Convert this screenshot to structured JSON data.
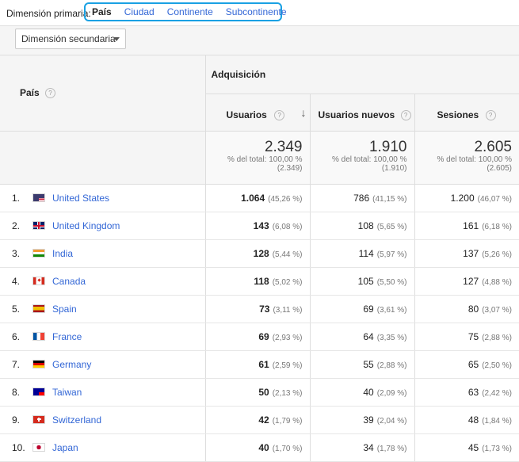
{
  "primary_dimension": {
    "label": "Dimensión primaria:",
    "tabs": [
      "País",
      "Ciudad",
      "Continente",
      "Subcontinente"
    ]
  },
  "secondary_dimension": {
    "label": "Dimensión secundaria"
  },
  "table": {
    "country_header": "País",
    "group_header": "Adquisición",
    "metric_headers": [
      "Usuarios",
      "Usuarios nuevos",
      "Sesiones"
    ],
    "totals": [
      {
        "value": "2.349",
        "line1": "% del total: 100,00 %",
        "line2": "(2.349)"
      },
      {
        "value": "1.910",
        "line1": "% del total: 100,00 %",
        "line2": "(1.910)"
      },
      {
        "value": "2.605",
        "line1": "% del total: 100,00 %",
        "line2": "(2.605)"
      }
    ],
    "rows": [
      {
        "index": "1.",
        "flag": "us-flag-icon",
        "country": "United States",
        "users": "1.064",
        "users_pct": "(45,26 %)",
        "new_users": "786",
        "new_users_pct": "(41,15 %)",
        "sessions": "1.200",
        "sessions_pct": "(46,07 %)"
      },
      {
        "index": "2.",
        "flag": "gb-flag-icon",
        "country": "United Kingdom",
        "users": "143",
        "users_pct": "(6,08 %)",
        "new_users": "108",
        "new_users_pct": "(5,65 %)",
        "sessions": "161",
        "sessions_pct": "(6,18 %)"
      },
      {
        "index": "3.",
        "flag": "in-flag-icon",
        "country": "India",
        "users": "128",
        "users_pct": "(5,44 %)",
        "new_users": "114",
        "new_users_pct": "(5,97 %)",
        "sessions": "137",
        "sessions_pct": "(5,26 %)"
      },
      {
        "index": "4.",
        "flag": "ca-flag-icon",
        "country": "Canada",
        "users": "118",
        "users_pct": "(5,02 %)",
        "new_users": "105",
        "new_users_pct": "(5,50 %)",
        "sessions": "127",
        "sessions_pct": "(4,88 %)"
      },
      {
        "index": "5.",
        "flag": "es-flag-icon",
        "country": "Spain",
        "users": "73",
        "users_pct": "(3,11 %)",
        "new_users": "69",
        "new_users_pct": "(3,61 %)",
        "sessions": "80",
        "sessions_pct": "(3,07 %)"
      },
      {
        "index": "6.",
        "flag": "fr-flag-icon",
        "country": "France",
        "users": "69",
        "users_pct": "(2,93 %)",
        "new_users": "64",
        "new_users_pct": "(3,35 %)",
        "sessions": "75",
        "sessions_pct": "(2,88 %)"
      },
      {
        "index": "7.",
        "flag": "de-flag-icon",
        "country": "Germany",
        "users": "61",
        "users_pct": "(2,59 %)",
        "new_users": "55",
        "new_users_pct": "(2,88 %)",
        "sessions": "65",
        "sessions_pct": "(2,50 %)"
      },
      {
        "index": "8.",
        "flag": "tw-flag-icon",
        "country": "Taiwan",
        "users": "50",
        "users_pct": "(2,13 %)",
        "new_users": "40",
        "new_users_pct": "(2,09 %)",
        "sessions": "63",
        "sessions_pct": "(2,42 %)"
      },
      {
        "index": "9.",
        "flag": "ch-flag-icon",
        "country": "Switzerland",
        "users": "42",
        "users_pct": "(1,79 %)",
        "new_users": "39",
        "new_users_pct": "(2,04 %)",
        "sessions": "48",
        "sessions_pct": "(1,84 %)"
      },
      {
        "index": "10.",
        "flag": "jp-flag-icon",
        "country": "Japan",
        "users": "40",
        "users_pct": "(1,70 %)",
        "new_users": "34",
        "new_users_pct": "(1,78 %)",
        "sessions": "45",
        "sessions_pct": "(1,73 %)"
      }
    ]
  },
  "colors": {
    "link": "#3367d6",
    "highlight_border": "#1aa1e3",
    "header_bg": "#f5f5f5"
  }
}
